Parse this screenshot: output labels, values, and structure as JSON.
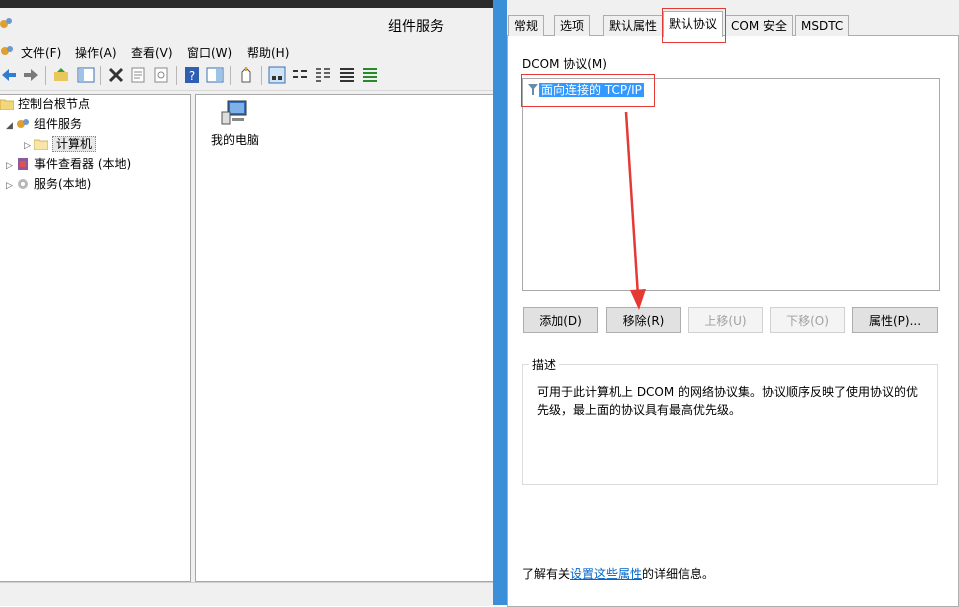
{
  "left_window": {
    "title": "组件服务",
    "menu": [
      "文件(F)",
      "操作(A)",
      "查看(V)",
      "窗口(W)",
      "帮助(H)"
    ],
    "tree": [
      {
        "label": "控制台根节点",
        "expander": ""
      },
      {
        "label": "组件服务",
        "expander": "◢"
      },
      {
        "label": "计算机",
        "expander": "▷"
      },
      {
        "label": "事件查看器 (本地)",
        "expander": "▷"
      },
      {
        "label": "服务(本地)",
        "expander": "▷"
      }
    ],
    "list_item": "我的电脑"
  },
  "dialog": {
    "tabs": [
      "常规",
      "选项",
      "默认属性",
      "默认协议",
      "COM 安全",
      "MSDTC"
    ],
    "active_tab": "默认协议",
    "protocol_label": "DCOM 协议(M)",
    "protocols": [
      "面向连接的 TCP/IP"
    ],
    "buttons": {
      "add": "添加(D)",
      "remove": "移除(R)",
      "move_up": "上移(U)",
      "move_down": "下移(O)",
      "properties": "属性(P)..."
    },
    "description_legend": "描述",
    "description": "可用于此计算机上 DCOM 的网络协议集。协议顺序反映了使用协议的优先级，最上面的协议具有最高优先级。",
    "footer_prefix": "了解有关",
    "footer_link": "设置这些属性",
    "footer_suffix": "的详细信息。"
  },
  "colors": {
    "selection": "#3399ff",
    "annotation": "#e53935",
    "accent": "#3a8fd8"
  }
}
